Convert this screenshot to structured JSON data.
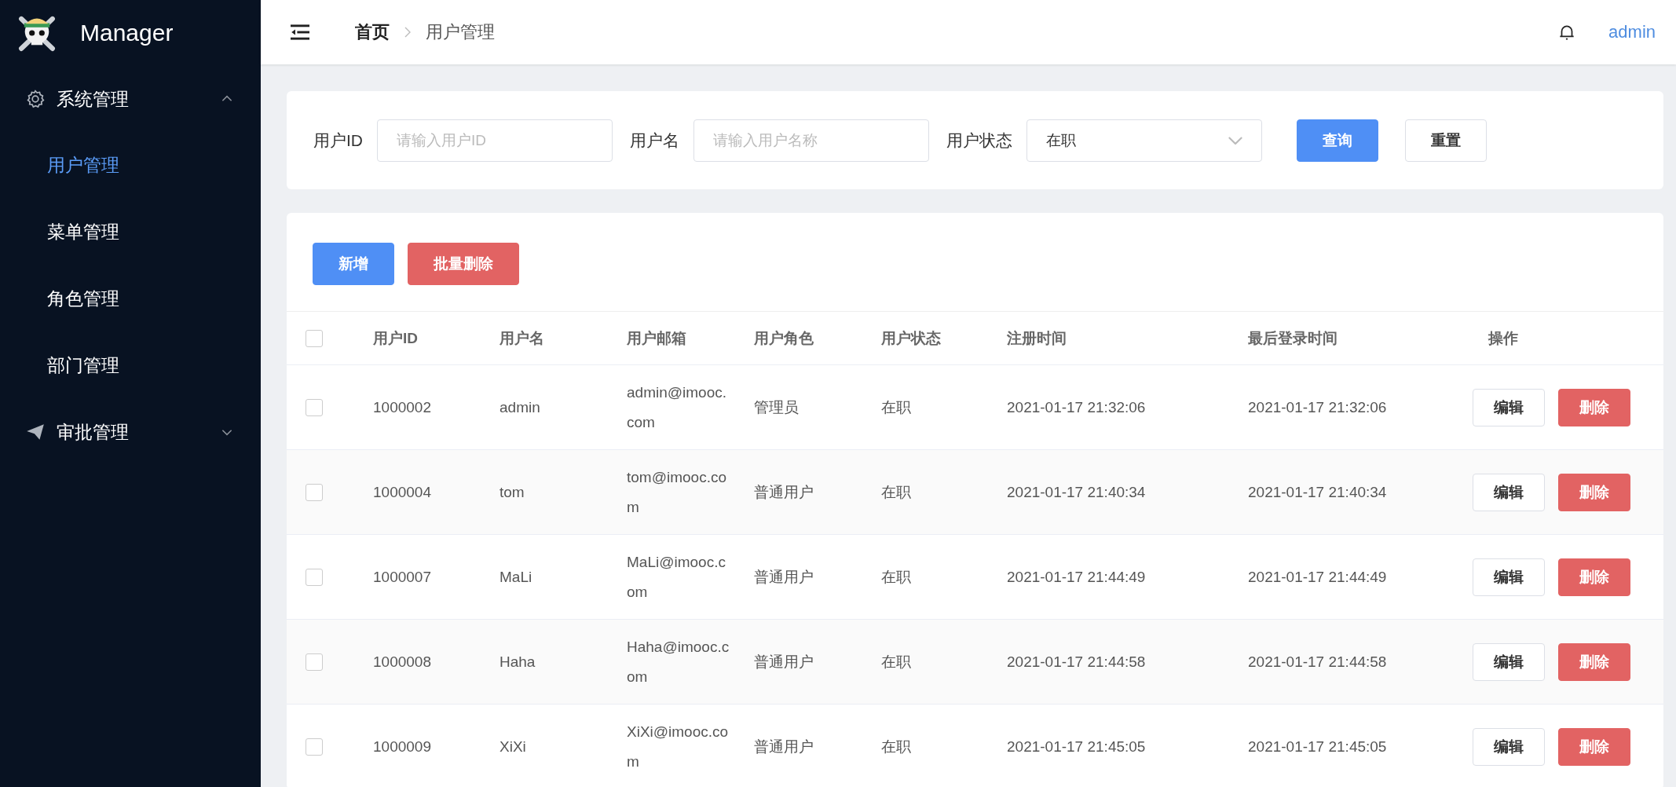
{
  "sidebar": {
    "brand": "Manager",
    "groups": [
      {
        "label": "系统管理",
        "expanded": true,
        "items": [
          {
            "label": "用户管理",
            "selected": true
          },
          {
            "label": "菜单管理",
            "selected": false
          },
          {
            "label": "角色管理",
            "selected": false
          },
          {
            "label": "部门管理",
            "selected": false
          }
        ]
      },
      {
        "label": "审批管理",
        "expanded": false
      }
    ]
  },
  "header": {
    "breadcrumb": [
      "首页",
      "用户管理"
    ],
    "user": "admin"
  },
  "filter": {
    "fields": [
      {
        "kind": "input",
        "label": "用户ID",
        "placeholder": "请输入用户ID"
      },
      {
        "kind": "input",
        "label": "用户名",
        "placeholder": "请输入用户名称"
      },
      {
        "kind": "select",
        "label": "用户状态",
        "value": "在职"
      }
    ],
    "buttons": [
      {
        "label": "查询",
        "kind": "primary"
      },
      {
        "label": "重置",
        "kind": "default"
      }
    ]
  },
  "toolbar": [
    {
      "label": "新增",
      "kind": "primary"
    },
    {
      "label": "批量删除",
      "kind": "danger"
    }
  ],
  "table": {
    "columns": [
      "用户ID",
      "用户名",
      "用户邮箱",
      "用户角色",
      "用户状态",
      "注册时间",
      "最后登录时间",
      "操作"
    ],
    "all_checked": false,
    "rows": [
      {
        "checked": false,
        "cells": [
          "1000002",
          "admin",
          "admin@imooc.com",
          "管理员",
          "在职",
          "2021-01-17 21:32:06",
          "2021-01-17 21:32:06"
        ],
        "actions": [
          {
            "label": "编辑",
            "kind": "default"
          },
          {
            "label": "删除",
            "kind": "danger"
          }
        ]
      },
      {
        "checked": false,
        "cells": [
          "1000004",
          "tom",
          "tom@imooc.com",
          "普通用户",
          "在职",
          "2021-01-17 21:40:34",
          "2021-01-17 21:40:34"
        ],
        "actions": [
          {
            "label": "编辑",
            "kind": "default"
          },
          {
            "label": "删除",
            "kind": "danger"
          }
        ]
      },
      {
        "checked": false,
        "cells": [
          "1000007",
          "MaLi",
          "MaLi@imooc.com",
          "普通用户",
          "在职",
          "2021-01-17 21:44:49",
          "2021-01-17 21:44:49"
        ],
        "actions": [
          {
            "label": "编辑",
            "kind": "default"
          },
          {
            "label": "删除",
            "kind": "danger"
          }
        ]
      },
      {
        "checked": false,
        "cells": [
          "1000008",
          "Haha",
          "Haha@imooc.com",
          "普通用户",
          "在职",
          "2021-01-17 21:44:58",
          "2021-01-17 21:44:58"
        ],
        "actions": [
          {
            "label": "编辑",
            "kind": "default"
          },
          {
            "label": "删除",
            "kind": "danger"
          }
        ]
      },
      {
        "checked": false,
        "cells": [
          "1000009",
          "XiXi",
          "XiXi@imooc.com",
          "普通用户",
          "在职",
          "2021-01-17 21:45:05",
          "2021-01-17 21:45:05"
        ],
        "actions": [
          {
            "label": "编辑",
            "kind": "default"
          },
          {
            "label": "删除",
            "kind": "danger"
          }
        ]
      }
    ]
  }
}
